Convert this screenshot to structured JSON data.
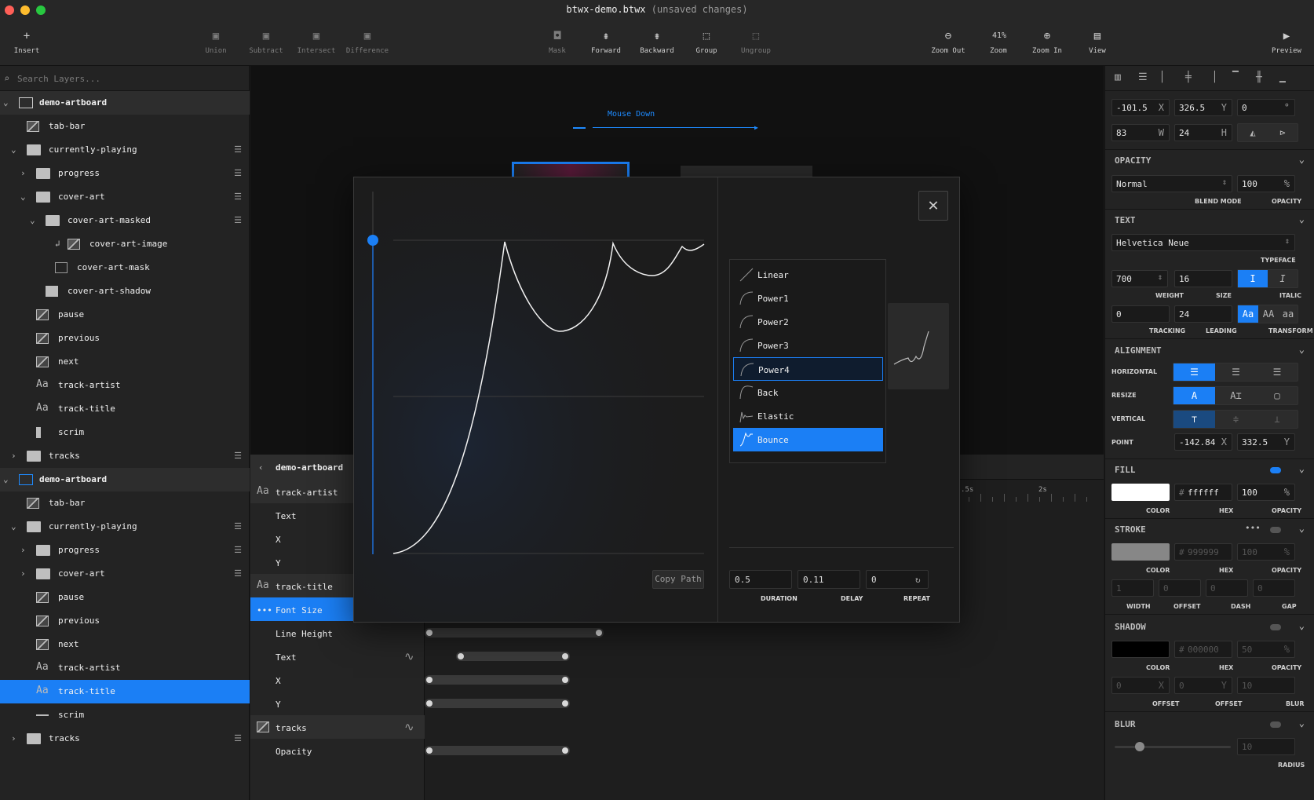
{
  "window": {
    "title": "btwx-demo.btwx",
    "subtitle": "(unsaved changes)"
  },
  "toolbar": {
    "insert": "Insert",
    "union": "Union",
    "subtract": "Subtract",
    "intersect": "Intersect",
    "difference": "Difference",
    "mask": "Mask",
    "forward": "Forward",
    "backward": "Backward",
    "group": "Group",
    "ungroup": "Ungroup",
    "zoom_out": "Zoom Out",
    "zoom_value": "41%",
    "zoom": "Zoom",
    "zoom_in": "Zoom In",
    "view": "View",
    "preview": "Preview"
  },
  "search": {
    "placeholder": "Search Layers..."
  },
  "layers": [
    {
      "label": "demo-artboard",
      "icon": "artboard-icon"
    },
    {
      "label": "tab-bar",
      "icon": "image-icon"
    },
    {
      "label": "currently-playing",
      "icon": "folder-icon"
    },
    {
      "label": "progress",
      "icon": "folder-icon"
    },
    {
      "label": "cover-art",
      "icon": "folder-icon"
    },
    {
      "label": "cover-art-masked",
      "icon": "folder-icon"
    },
    {
      "label": "cover-art-image",
      "icon": "image-icon"
    },
    {
      "label": "cover-art-mask",
      "icon": "shape-icon"
    },
    {
      "label": "cover-art-shadow",
      "icon": "shape-icon"
    },
    {
      "label": "pause",
      "icon": "image-icon"
    },
    {
      "label": "previous",
      "icon": "image-icon"
    },
    {
      "label": "next",
      "icon": "image-icon"
    },
    {
      "label": "track-artist",
      "icon": "text-icon"
    },
    {
      "label": "track-title",
      "icon": "text-icon"
    },
    {
      "label": "scrim",
      "icon": "shape-icon"
    },
    {
      "label": "tracks",
      "icon": "folder-icon"
    },
    {
      "label": "demo-artboard",
      "icon": "artboard-icon"
    },
    {
      "label": "tab-bar",
      "icon": "image-icon"
    },
    {
      "label": "currently-playing",
      "icon": "folder-icon"
    },
    {
      "label": "progress",
      "icon": "folder-icon"
    },
    {
      "label": "cover-art",
      "icon": "folder-icon"
    },
    {
      "label": "pause",
      "icon": "image-icon"
    },
    {
      "label": "previous",
      "icon": "image-icon"
    },
    {
      "label": "next",
      "icon": "image-icon"
    },
    {
      "label": "track-artist",
      "icon": "text-icon"
    },
    {
      "label": "track-title",
      "icon": "text-icon"
    },
    {
      "label": "scrim",
      "icon": "shape-icon"
    },
    {
      "label": "tracks",
      "icon": "folder-icon"
    }
  ],
  "canvas": {
    "event_label": "Mouse Down",
    "time_5s": ".5s",
    "time_2s": "2s"
  },
  "timeline": {
    "artboard": "demo-artboard",
    "rows": [
      "track-artist",
      "Text",
      "X",
      "Y",
      "track-title",
      "Font Size",
      "Line Height",
      "Text",
      "X",
      "Y",
      "tracks",
      "Opacity"
    ]
  },
  "ease_modal": {
    "options": [
      "Linear",
      "Power1",
      "Power2",
      "Power3",
      "Power4",
      "Back",
      "Elastic",
      "Bounce"
    ],
    "selected": "Bounce",
    "hovered": "Power4",
    "copy_path": "Copy Path",
    "duration": "0.5",
    "delay": "0.11",
    "repeat": "0",
    "duration_label": "DURATION",
    "delay_label": "DELAY",
    "repeat_label": "REPEAT"
  },
  "props": {
    "x": "-101.5",
    "y": "326.5",
    "rotation": "0",
    "w": "83",
    "h": "24",
    "opacity_title": "OPACITY",
    "blend_mode": "Normal",
    "opacity": "100",
    "blend_label": "BLEND MODE",
    "opacity_label": "OPACITY",
    "text_title": "TEXT",
    "typeface": "Helvetica Neue",
    "typeface_label": "TYPEFACE",
    "weight": "700",
    "size": "16",
    "weight_label": "WEIGHT",
    "size_label": "SIZE",
    "italic_label": "ITALIC",
    "tracking": "0",
    "leading": "24",
    "tracking_label": "TRACKING",
    "leading_label": "LEADING",
    "transform_label": "TRANSFORM",
    "alignment_title": "ALIGNMENT",
    "horizontal": "HORIZONTAL",
    "resize": "RESIZE",
    "vertical": "VERTICAL",
    "point": "POINT",
    "point_x": "-142.84",
    "point_y": "332.5",
    "fill_title": "FILL",
    "fill_hex": "ffffff",
    "fill_opacity": "100",
    "color_label": "COLOR",
    "hex_label": "HEX",
    "stroke_title": "STROKE",
    "stroke_hex": "999999",
    "stroke_opacity": "100",
    "stroke_width": "1",
    "stroke_offset": "0",
    "stroke_dash": "0",
    "stroke_gap": "0",
    "width_label": "WIDTH",
    "offset_label": "OFFSET",
    "dash_label": "DASH",
    "gap_label": "GAP",
    "shadow_title": "SHADOW",
    "shadow_hex": "000000",
    "shadow_opacity": "50",
    "shadow_x": "0",
    "shadow_y": "0",
    "shadow_blur": "10",
    "blur_label": "BLUR",
    "blur_title": "BLUR",
    "blur_radius": "10",
    "radius_label": "RADIUS",
    "unit_x": "X",
    "unit_y": "Y",
    "unit_w": "W",
    "unit_h": "H",
    "unit_pct": "%",
    "unit_deg": "°",
    "hash": "#",
    "tt_aa": "Aa",
    "tt_AA": "AA",
    "tt_lower": "aa"
  },
  "colors": {
    "accent": "#1b7ff5",
    "bg": "#1b1b1b"
  }
}
